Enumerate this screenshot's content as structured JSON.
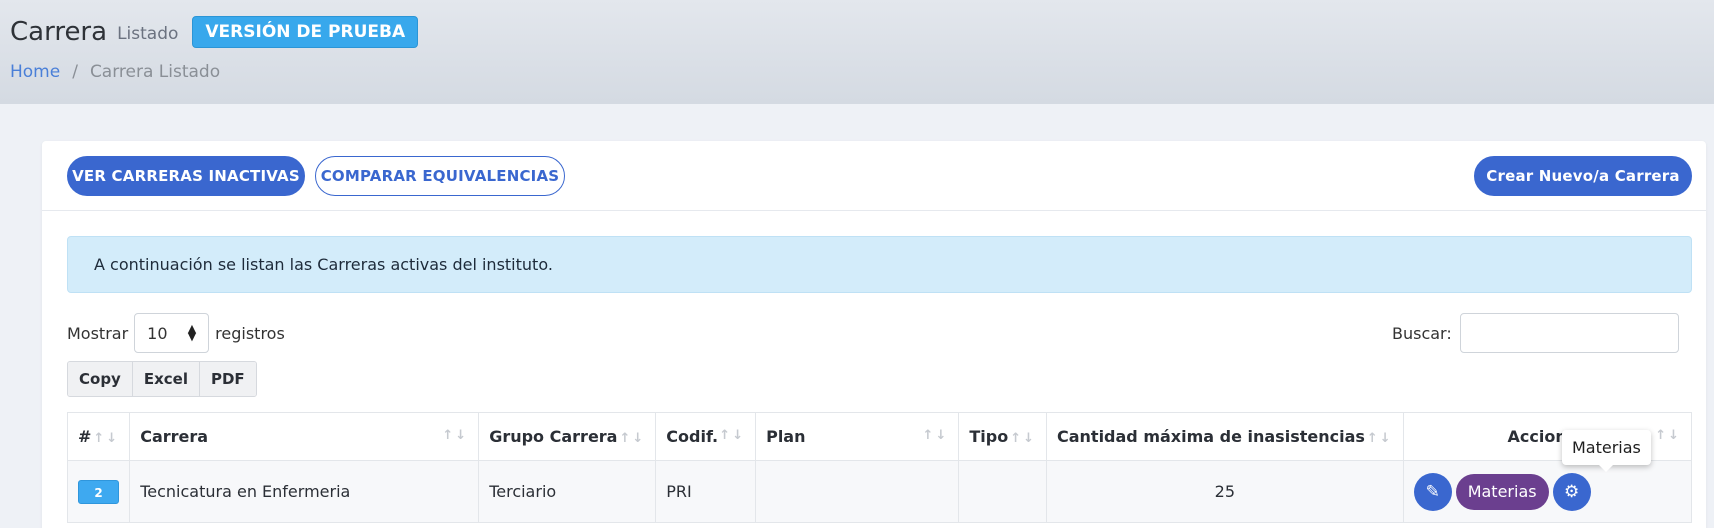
{
  "header": {
    "title": "Carrera",
    "subtitle": "Listado",
    "badge": "VERSIÓN DE PRUEBA",
    "breadcrumb": {
      "home": "Home",
      "separator": "/",
      "current": "Carrera Listado"
    }
  },
  "toolbar": {
    "inactive_label": "VER CARRERAS INACTIVAS",
    "compare_label": "COMPARAR EQUIVALENCIAS",
    "create_label": "Crear Nuevo/a Carrera"
  },
  "alert": {
    "text": "A continuación se listan las Carreras activas del instituto."
  },
  "length": {
    "prefix": "Mostrar",
    "value": "10",
    "suffix": "registros"
  },
  "search": {
    "label": "Buscar:",
    "value": "",
    "placeholder": ""
  },
  "export": {
    "copy": "Copy",
    "excel": "Excel",
    "pdf": "PDF"
  },
  "table": {
    "sort_arrows": "↑↓",
    "columns": {
      "num": "#",
      "carrera": "Carrera",
      "grupo": "Grupo Carrera",
      "codif": "Codif.",
      "plan": "Plan",
      "tipo": "Tipo",
      "cantidad": "Cantidad máxima de inasistencias",
      "acciones": "Acciones"
    },
    "rows": [
      {
        "num": "2",
        "carrera": "Tecnicatura en Enfermeria",
        "grupo": "Terciario",
        "codif": "PRI",
        "plan": "",
        "tipo": "",
        "cantidad": "25",
        "materias_label": "Materias"
      }
    ]
  },
  "tooltip": {
    "text": "Materias"
  },
  "icons": {
    "edit": "edit-icon",
    "gear": "gear-icon",
    "sort": "sort-arrows-icon",
    "caret": "select-caret-icon"
  },
  "colors": {
    "primary": "#3a67cf",
    "badge": "#38a8ec",
    "info_bg": "#d3ecfa",
    "materias": "#6b3f8f"
  }
}
